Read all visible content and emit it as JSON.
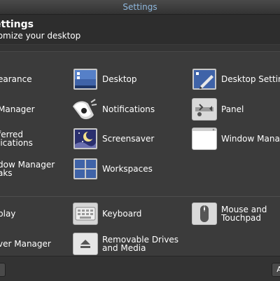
{
  "window": {
    "title": "Settings"
  },
  "header": {
    "title": "ettings",
    "subtitle": "tomize your desktop"
  },
  "items": [
    {
      "label": "earance"
    },
    {
      "label": "Desktop"
    },
    {
      "label": "Desktop Settin"
    },
    {
      "label": " Manager"
    },
    {
      "label": "Notifications"
    },
    {
      "label": "Panel"
    },
    {
      "label_line1": "ferred",
      "label_line2": "lications"
    },
    {
      "label": "Screensaver"
    },
    {
      "label": "Window Manag"
    },
    {
      "label_line1": "dow Manager",
      "label_line2": "aks"
    },
    {
      "label": "Workspaces"
    },
    {
      "label": "play"
    },
    {
      "label": "Keyboard"
    },
    {
      "label_line1": "Mouse and",
      "label_line2": "Touchpad"
    },
    {
      "label": "ver Manager"
    },
    {
      "label_line1": "Removable Drives",
      "label_line2": "and Media"
    }
  ],
  "footer": {
    "left_button": "",
    "right_button": "A"
  },
  "colors": {
    "accent_title": "#8fb8de",
    "background": "#3b3b3b"
  }
}
